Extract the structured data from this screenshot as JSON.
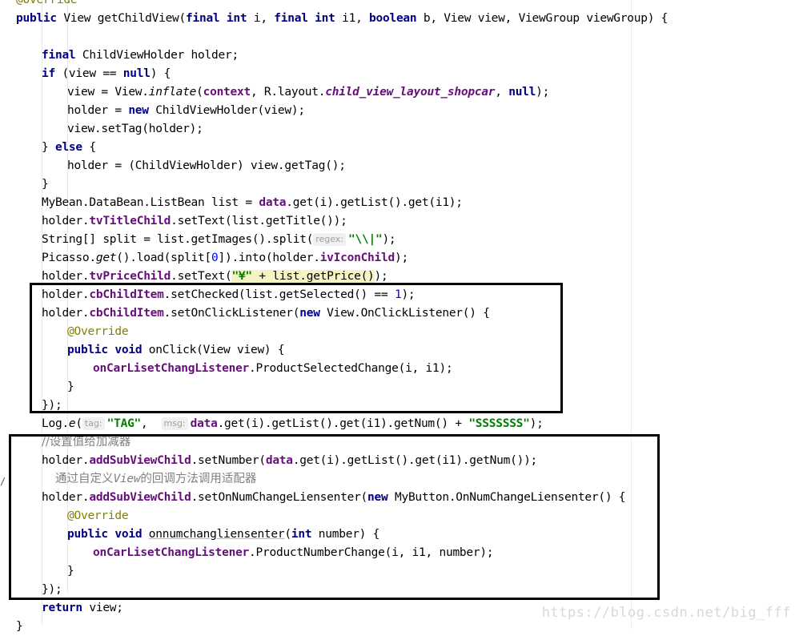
{
  "editor": {
    "lines": [
      {
        "indent": 1,
        "tokens": [
          {
            "t": "@Override",
            "c": "ann"
          }
        ]
      },
      {
        "indent": 1,
        "tokens": [
          {
            "t": "public",
            "c": "kw"
          },
          {
            "t": " View getChildView("
          },
          {
            "t": "final",
            "c": "kw"
          },
          {
            "t": " "
          },
          {
            "t": "int",
            "c": "kw"
          },
          {
            "t": " i, "
          },
          {
            "t": "final",
            "c": "kw"
          },
          {
            "t": " "
          },
          {
            "t": "int",
            "c": "kw"
          },
          {
            "t": " i1, "
          },
          {
            "t": "boolean",
            "c": "kw"
          },
          {
            "t": " b, View view, ViewGroup viewGroup) {"
          }
        ]
      },
      {
        "indent": 0,
        "tokens": []
      },
      {
        "indent": 2,
        "tokens": [
          {
            "t": "final",
            "c": "kw"
          },
          {
            "t": " ChildViewHolder holder;"
          }
        ]
      },
      {
        "indent": 2,
        "tokens": [
          {
            "t": "if",
            "c": "kw"
          },
          {
            "t": " (view == "
          },
          {
            "t": "null",
            "c": "kw"
          },
          {
            "t": ") {"
          }
        ]
      },
      {
        "indent": 3,
        "tokens": [
          {
            "t": "view = View."
          },
          {
            "t": "inflate",
            "c": "it"
          },
          {
            "t": "("
          },
          {
            "t": "context",
            "c": "fld"
          },
          {
            "t": ", R.layout."
          },
          {
            "t": "child_view_layout_shopcar",
            "c": "fldi"
          },
          {
            "t": ", "
          },
          {
            "t": "null",
            "c": "kw"
          },
          {
            "t": ");"
          }
        ]
      },
      {
        "indent": 3,
        "tokens": [
          {
            "t": "holder = "
          },
          {
            "t": "new",
            "c": "kw"
          },
          {
            "t": " ChildViewHolder(view);"
          }
        ]
      },
      {
        "indent": 3,
        "tokens": [
          {
            "t": "view.setTag(holder);"
          }
        ]
      },
      {
        "indent": 2,
        "tokens": [
          {
            "t": "} "
          },
          {
            "t": "else",
            "c": "kw"
          },
          {
            "t": " {"
          }
        ]
      },
      {
        "indent": 3,
        "tokens": [
          {
            "t": "holder = (ChildViewHolder) view.getTag();"
          }
        ]
      },
      {
        "indent": 2,
        "tokens": [
          {
            "t": "}"
          }
        ]
      },
      {
        "indent": 2,
        "tokens": [
          {
            "t": "MyBean.DataBean.ListBean list = "
          },
          {
            "t": "data",
            "c": "fld"
          },
          {
            "t": ".get(i).getList().get(i1);"
          }
        ]
      },
      {
        "indent": 2,
        "tokens": [
          {
            "t": "holder."
          },
          {
            "t": "tvTitleChild",
            "c": "fld"
          },
          {
            "t": ".setText(list.getTitle());"
          }
        ]
      },
      {
        "indent": 2,
        "tokens": [
          {
            "t": "String[] split = list.getImages().split("
          },
          {
            "t": "regex:",
            "c": "hint"
          },
          {
            "t": "\"\\\\|\"",
            "c": "str"
          },
          {
            "t": ");"
          }
        ]
      },
      {
        "indent": 2,
        "tokens": [
          {
            "t": "Picasso."
          },
          {
            "t": "get",
            "c": "it"
          },
          {
            "t": "().load(split["
          },
          {
            "t": "0",
            "c": "num"
          },
          {
            "t": "]).into(holder."
          },
          {
            "t": "ivIconChild",
            "c": "fld"
          },
          {
            "t": ");"
          }
        ]
      },
      {
        "indent": 2,
        "tokens": [
          {
            "t": "holder."
          },
          {
            "t": "tvPriceChild",
            "c": "fld"
          },
          {
            "t": ".setText("
          },
          {
            "t": "\"¥\"",
            "c": "str hl"
          },
          {
            "t": " + list.getPrice()",
            "c": "hl"
          },
          {
            "t": ");"
          }
        ]
      },
      {
        "indent": 2,
        "tokens": [
          {
            "t": "holder."
          },
          {
            "t": "cbChildItem",
            "c": "fld"
          },
          {
            "t": ".setChecked(list.getSelected() == "
          },
          {
            "t": "1",
            "c": "num"
          },
          {
            "t": ");"
          }
        ]
      },
      {
        "indent": 2,
        "tokens": [
          {
            "t": "holder."
          },
          {
            "t": "cbChildItem",
            "c": "fld"
          },
          {
            "t": ".setOnClickListener("
          },
          {
            "t": "new",
            "c": "kw"
          },
          {
            "t": " View.OnClickListener() {"
          }
        ]
      },
      {
        "indent": 3,
        "tokens": [
          {
            "t": "@Override",
            "c": "ann"
          }
        ]
      },
      {
        "indent": 3,
        "tokens": [
          {
            "t": "public",
            "c": "kw"
          },
          {
            "t": " "
          },
          {
            "t": "void",
            "c": "kw"
          },
          {
            "t": " onClick(View view) {"
          }
        ]
      },
      {
        "indent": 4,
        "tokens": [
          {
            "t": "onCarLisetChangListener",
            "c": "fld"
          },
          {
            "t": ".ProductSelectedChange(i, i1);"
          }
        ]
      },
      {
        "indent": 3,
        "tokens": [
          {
            "t": "}"
          }
        ]
      },
      {
        "indent": 2,
        "tokens": [
          {
            "t": "});"
          }
        ]
      },
      {
        "indent": 2,
        "tokens": [
          {
            "t": "Log."
          },
          {
            "t": "e",
            "c": "it"
          },
          {
            "t": "("
          },
          {
            "t": "tag:",
            "c": "hint"
          },
          {
            "t": "\"TAG\"",
            "c": "str"
          },
          {
            "t": ",  "
          },
          {
            "t": "msg:",
            "c": "hint"
          },
          {
            "t": "data",
            "c": "fld"
          },
          {
            "t": ".get(i).getList().get(i1).getNum() + "
          },
          {
            "t": "\"SSSSSSS\"",
            "c": "str"
          },
          {
            "t": ");"
          }
        ]
      },
      {
        "indent": 2,
        "tokens": [
          {
            "t": "//设置值给加减器",
            "c": "cmt"
          }
        ]
      },
      {
        "indent": 2,
        "tokens": [
          {
            "t": "holder."
          },
          {
            "t": "addSubViewChild",
            "c": "fld"
          },
          {
            "t": ".setNumber("
          },
          {
            "t": "data",
            "c": "fld"
          },
          {
            "t": ".get(i).getList().get(i1).getNum());"
          }
        ]
      },
      {
        "indent": 2,
        "extra": "  ",
        "tokens": [
          {
            "t": "通过自定义",
            "c": "cmt"
          },
          {
            "t": "View",
            "c": "cmt it"
          },
          {
            "t": "的回调方法调用适配器",
            "c": "cmt"
          }
        ]
      },
      {
        "indent": 2,
        "tokens": [
          {
            "t": "holder."
          },
          {
            "t": "addSubViewChild",
            "c": "fld"
          },
          {
            "t": ".setOnNumChangeLiensenter("
          },
          {
            "t": "new",
            "c": "kw"
          },
          {
            "t": " MyButton.OnNumChangeLiensenter() {"
          }
        ]
      },
      {
        "indent": 3,
        "tokens": [
          {
            "t": "@Override",
            "c": "ann"
          }
        ]
      },
      {
        "indent": 3,
        "tokens": [
          {
            "t": "public",
            "c": "kw"
          },
          {
            "t": " "
          },
          {
            "t": "void",
            "c": "kw"
          },
          {
            "t": " "
          },
          {
            "t": "onnumchangliensenter",
            "c": "uline"
          },
          {
            "t": "("
          },
          {
            "t": "int",
            "c": "kw"
          },
          {
            "t": " number) {"
          }
        ]
      },
      {
        "indent": 4,
        "tokens": [
          {
            "t": "onCarLisetChangListener",
            "c": "fld"
          },
          {
            "t": ".ProductNumberChange(i, i1, number);"
          }
        ]
      },
      {
        "indent": 3,
        "tokens": [
          {
            "t": "}"
          }
        ]
      },
      {
        "indent": 2,
        "tokens": [
          {
            "t": "});"
          }
        ]
      },
      {
        "indent": 2,
        "tokens": [
          {
            "t": "return",
            "c": "kw"
          },
          {
            "t": " view;"
          }
        ]
      },
      {
        "indent": 1,
        "tokens": [
          {
            "t": "}"
          }
        ]
      }
    ]
  },
  "watermark": "https://blog.csdn.net/big_fff"
}
